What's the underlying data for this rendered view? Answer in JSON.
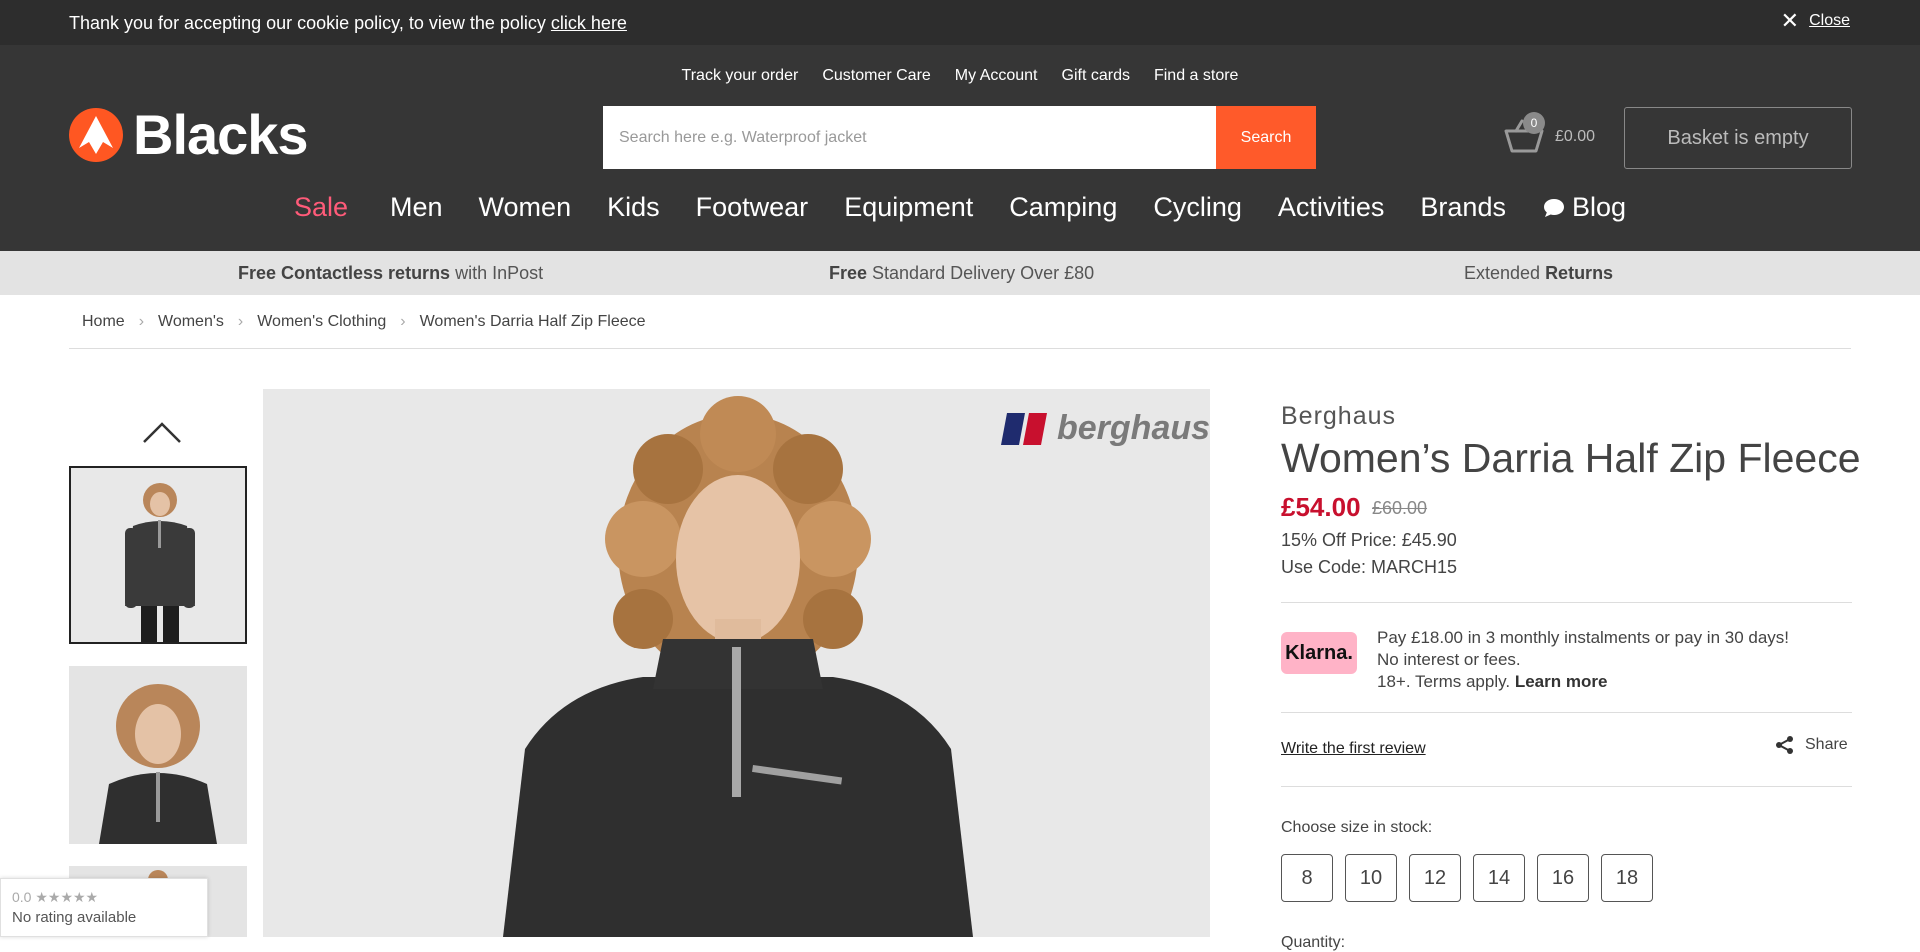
{
  "cookie": {
    "text": "Thank you for accepting our cookie policy, to view the policy ",
    "link": "click here",
    "close": "Close"
  },
  "header": {
    "top_links": [
      "Track your order",
      "Customer Care",
      "My Account",
      "Gift cards",
      "Find a store"
    ],
    "logo": "Blacks",
    "search_placeholder": "Search here e.g. Waterproof jacket",
    "search_button": "Search",
    "basket_count": "0",
    "basket_total": "£0.00",
    "basket_status": "Basket is empty",
    "nav": [
      "Sale",
      "Men",
      "Women",
      "Kids",
      "Footwear",
      "Equipment",
      "Camping",
      "Cycling",
      "Activities",
      "Brands",
      "Blog"
    ]
  },
  "promo": {
    "p1_bold": "Free Contactless returns",
    "p1_rest": " with InPost",
    "p2_bold": "Free",
    "p2_rest": " Standard Delivery Over £80",
    "p3_rest": "Extended ",
    "p3_bold": "Returns"
  },
  "breadcrumb": [
    "Home",
    "Women's",
    "Women's Clothing",
    "Women's Darria Half Zip Fleece"
  ],
  "product": {
    "image_brand": "berghaus",
    "brand": "Berghaus",
    "title": "Women’s Darria Half Zip Fleece",
    "price": "£54.00",
    "was_price": "£60.00",
    "offer": "15% Off Price: £45.90",
    "code": "Use Code: MARCH15",
    "klarna_logo": "Klarna.",
    "klarna_line1": "Pay £18.00 in 3 monthly instalments or pay in 30 days!",
    "klarna_line2": "No interest or fees.",
    "klarna_line3": "18+. Terms apply. ",
    "klarna_learn": "Learn more",
    "review_link": "Write the first review",
    "share": "Share",
    "size_label": "Choose size in stock:",
    "sizes": [
      "8",
      "10",
      "12",
      "14",
      "16",
      "18"
    ],
    "quantity_label": "Quantity:"
  },
  "rating": {
    "score": "0.0 ★★★★★",
    "text": "No rating available"
  },
  "colors": {
    "header_bg": "#363636",
    "accent": "#ff5a2a",
    "sale": "#ff5b79",
    "price": "#c8102e",
    "klarna": "#ffb3c7"
  }
}
